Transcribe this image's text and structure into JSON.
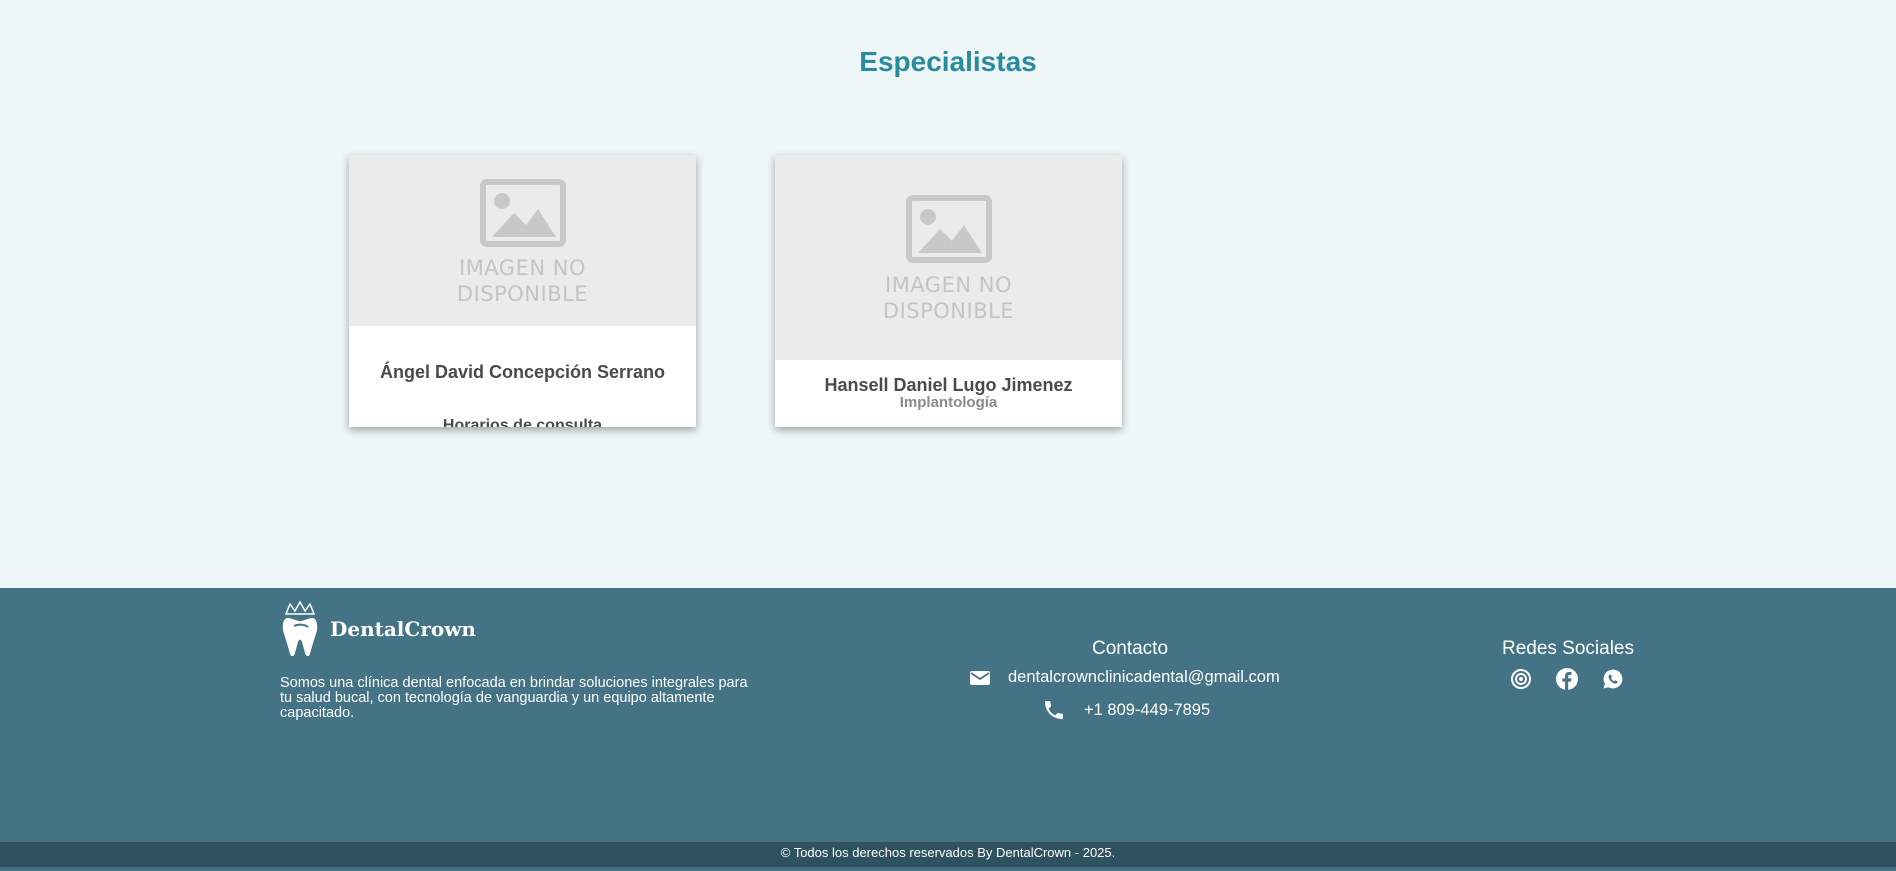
{
  "page": {
    "title": "Especialistas"
  },
  "placeholder": {
    "text_line1": "IMAGEN NO",
    "text_line2": "DISPONIBLE",
    "icon": "image-placeholder-icon"
  },
  "specialists": [
    {
      "name": "Ángel David Concepción Serrano",
      "subtitle": "Horarios de consulta"
    },
    {
      "name": "Hansell Daniel Lugo Jimenez",
      "specialty": "Implantología"
    }
  ],
  "footer": {
    "brand": "DentalCrown",
    "about": "Somos una clínica dental enfocada en brindar soluciones integrales para tu salud bucal, con tecnología de vanguardia y un equipo altamente capacitado.",
    "contact_title": "Contacto",
    "email": "dentalcrownclinicadental@gmail.com",
    "phone": "+1 809-449-7895",
    "social_title": "Redes Sociales",
    "social_icons": [
      "instagram-icon",
      "facebook-icon",
      "whatsapp-icon"
    ],
    "copyright": "© Todos los derechos reservados By DentalCrown - 2025."
  },
  "colors": {
    "title": "#2b8a9c",
    "background": "#eef7f8",
    "footer": "#447385",
    "bottom_bar": "#2f5261"
  }
}
